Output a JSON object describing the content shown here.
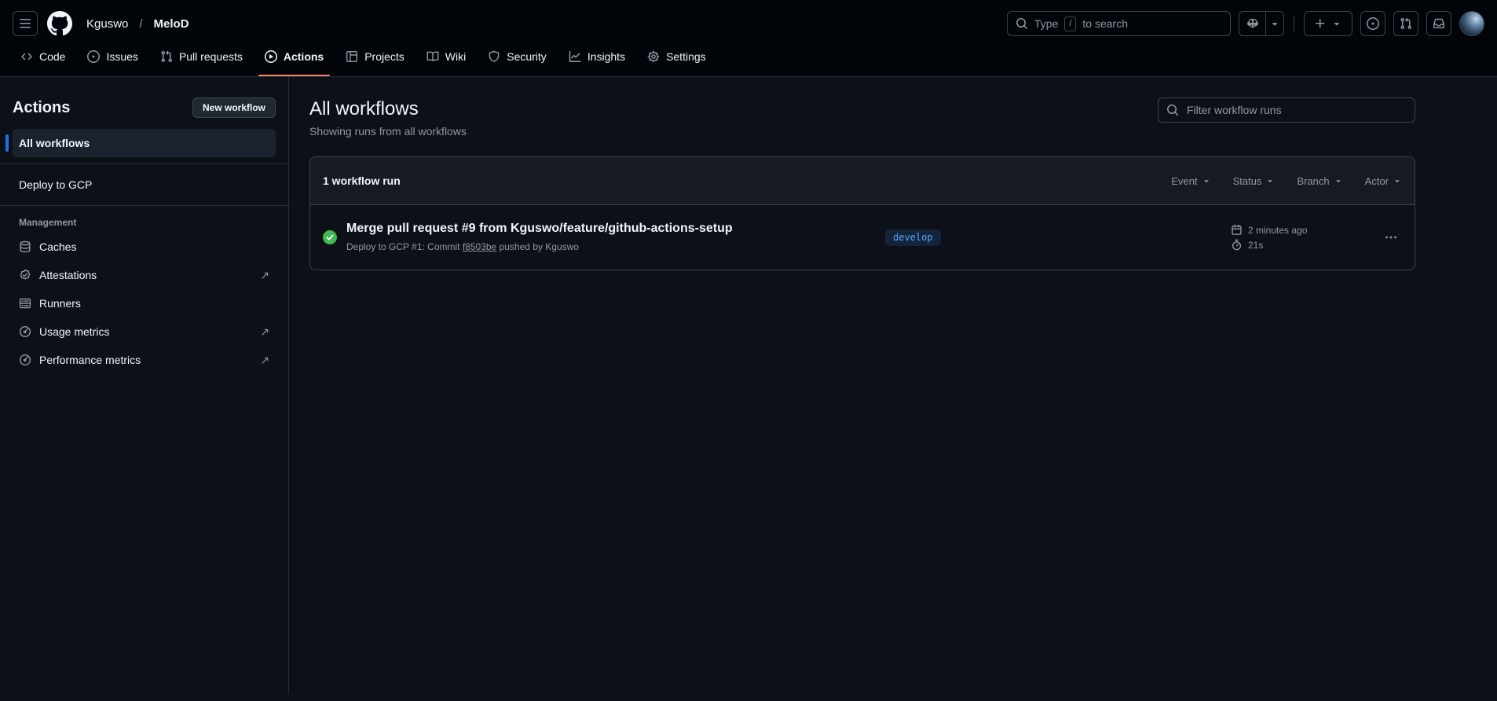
{
  "header": {
    "breadcrumb": {
      "owner": "Kguswo",
      "separator": "/",
      "repo": "MeloD"
    },
    "search": {
      "prefix": "Type",
      "key_hint": "/",
      "suffix": "to search"
    }
  },
  "tabs": [
    {
      "label": "Code"
    },
    {
      "label": "Issues"
    },
    {
      "label": "Pull requests"
    },
    {
      "label": "Actions"
    },
    {
      "label": "Projects"
    },
    {
      "label": "Wiki"
    },
    {
      "label": "Security"
    },
    {
      "label": "Insights"
    },
    {
      "label": "Settings"
    }
  ],
  "sidebar": {
    "title": "Actions",
    "new_workflow_label": "New workflow",
    "all_workflows_label": "All workflows",
    "workflows": [
      {
        "label": "Deploy to GCP"
      }
    ],
    "management_title": "Management",
    "management_items": [
      {
        "label": "Caches"
      },
      {
        "label": "Attestations"
      },
      {
        "label": "Runners"
      },
      {
        "label": "Usage metrics"
      },
      {
        "label": "Performance metrics"
      }
    ],
    "external_arrow": "↗"
  },
  "main": {
    "title": "All workflows",
    "subtitle": "Showing runs from all workflows",
    "filter_placeholder": "Filter workflow runs",
    "runs_panel": {
      "count_label": "1 workflow run",
      "filters": [
        {
          "label": "Event"
        },
        {
          "label": "Status"
        },
        {
          "label": "Branch"
        },
        {
          "label": "Actor"
        }
      ],
      "runs": [
        {
          "title": "Merge pull request #9 from Kguswo/feature/github-actions-setup",
          "description_prefix": "Deploy to GCP #1: Commit ",
          "commit": "f8503be",
          "description_suffix": " pushed by Kguswo",
          "branch": "develop",
          "time": "2 minutes ago",
          "duration": "21s",
          "status": "success"
        }
      ]
    }
  },
  "colors": {
    "page_background": "#0d1117",
    "header_background": "#010409",
    "panel_header_background": "#161b22",
    "border": "#3d444d",
    "accent_blue": "#58a6ff",
    "selected_bar_blue": "#1f6feb",
    "tab_underline_orange": "#f78166",
    "success_green": "#3fb950",
    "muted_text": "#9198a1"
  }
}
